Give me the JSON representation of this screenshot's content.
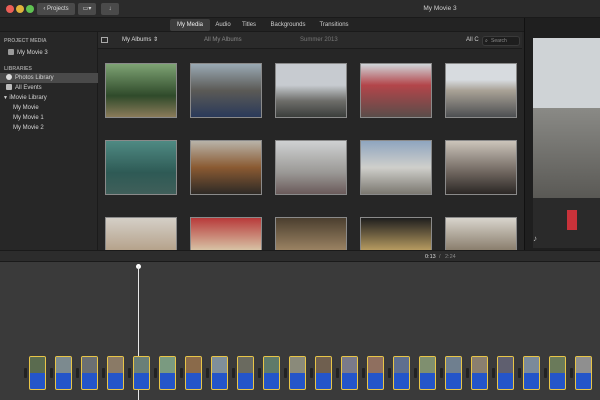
{
  "window": {
    "title": "My Movie 3"
  },
  "toolbar": {
    "projects_label": "Projects"
  },
  "tabs": [
    {
      "label": "My Media",
      "active": true
    },
    {
      "label": "Audio",
      "active": false
    },
    {
      "label": "Titles",
      "active": false
    },
    {
      "label": "Backgrounds",
      "active": false
    },
    {
      "label": "Transitions",
      "active": false
    }
  ],
  "sidebar": {
    "project_media_heading": "PROJECT MEDIA",
    "project_item": "My Movie 3",
    "libraries_heading": "LIBRARIES",
    "items": [
      {
        "label": "Photos Library",
        "selected": true
      },
      {
        "label": "All Events",
        "selected": false
      },
      {
        "label": "iMovie Library",
        "selected": false
      },
      {
        "label": "My Movie",
        "selected": false
      },
      {
        "label": "My Movie 1",
        "selected": false
      },
      {
        "label": "My Movie 2",
        "selected": false
      }
    ]
  },
  "browser": {
    "albums_dropdown": "My Albums",
    "crumb_all": "All My Albums",
    "crumb_current": "Summer 2013",
    "filter_label": "All C",
    "search_placeholder": "Search"
  },
  "timeline": {
    "current_time": "0:13",
    "separator": "/",
    "total_time": "2:24"
  },
  "colors": {
    "accent_clip_border": "#e8c547",
    "clip_audio": "#2455c9",
    "selection": "#4a4a4a"
  }
}
